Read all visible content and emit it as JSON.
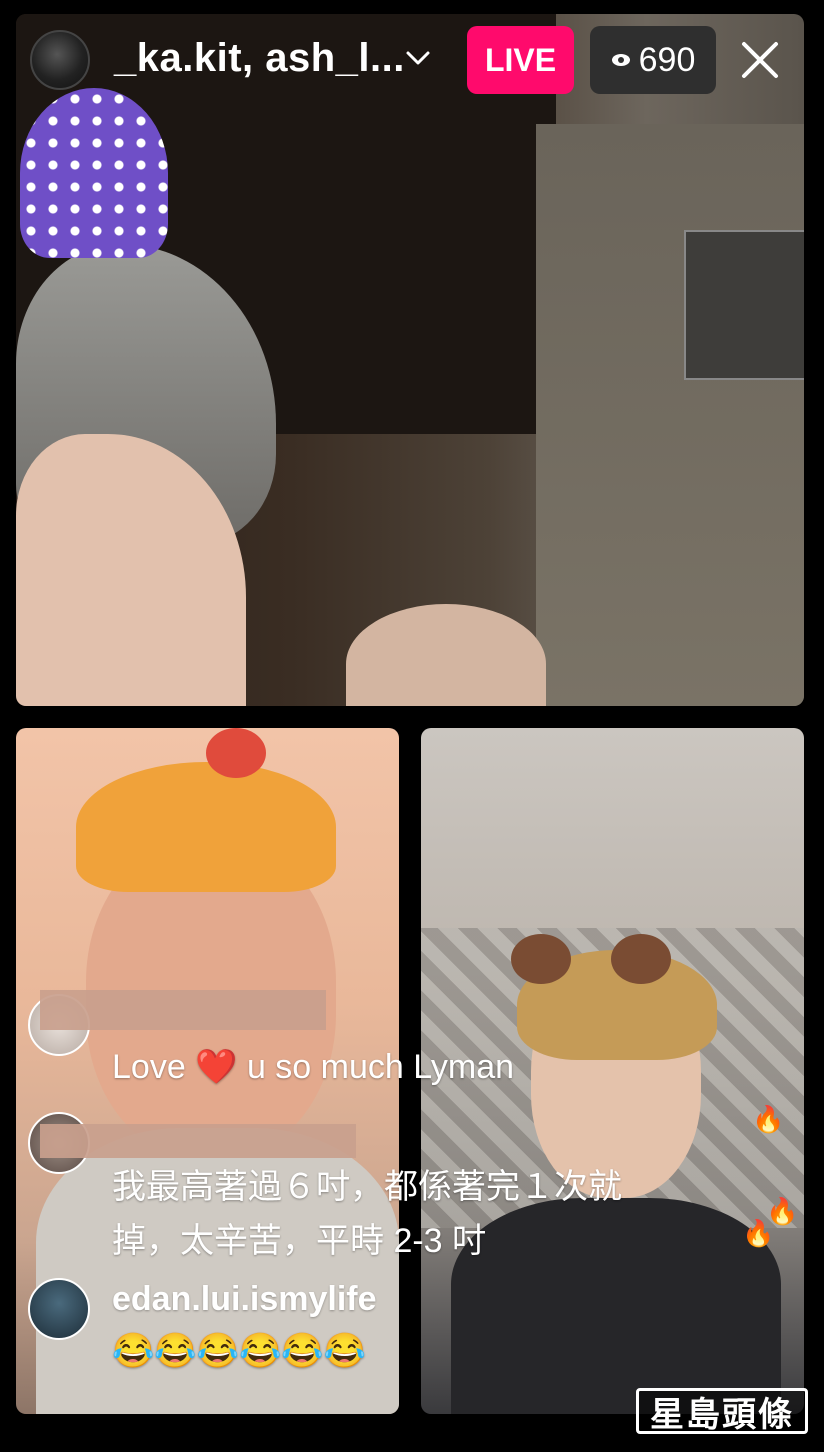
{
  "header": {
    "host_names": "_ka.kit, ash_l...",
    "live_label": "LIVE",
    "viewer_count": "690"
  },
  "comments": [
    {
      "username": "",
      "text": "Love ❤️ u so much Lyman"
    },
    {
      "username": "",
      "text": "我最高著過６吋，都係著完１次就\n掉，太辛苦，平時 2-3 吋"
    },
    {
      "username": "edan.lui.ismylife",
      "text": "😂😂😂😂😂😂"
    }
  ],
  "watermark": "星島頭條",
  "colors": {
    "live": "#ff0a6c",
    "viewer_badge": "#2f2f2f",
    "background": "#000000"
  },
  "icons": [
    "chevron-down-icon",
    "eye-icon",
    "close-icon",
    "fire-icon"
  ]
}
